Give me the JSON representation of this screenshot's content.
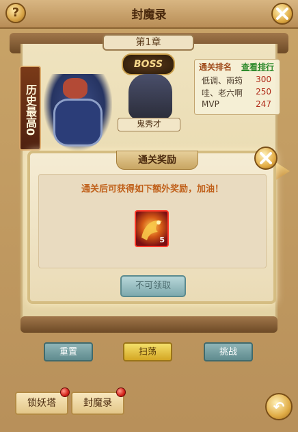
{
  "header": {
    "title": "封魔录",
    "help_icon_text": "?",
    "close_icon": "close-icon"
  },
  "scroll": {
    "chapter_label": "第1章",
    "history_label": "历史最高0"
  },
  "boss": {
    "badge_text": "BOSS",
    "name": "鬼秀才"
  },
  "ranking": {
    "title": "通关排名",
    "link": "查看排行",
    "rows": [
      {
        "name": "低调、雨筠",
        "score": "300"
      },
      {
        "name": "哇、老六啊",
        "score": "250"
      },
      {
        "name": "MVP",
        "score": "247"
      }
    ]
  },
  "modal": {
    "title": "通关奖励",
    "message": "通关后可获得如下额外奖励，加油！",
    "reward": {
      "icon": "dragon-item-icon",
      "count": "5"
    },
    "claim_button": "不可领取",
    "close_icon": "close-icon"
  },
  "actions": {
    "reset": "重置",
    "sweep": "扫荡",
    "challenge": "挑战"
  },
  "bottom_tabs": {
    "lock_demon_tower": "锁妖塔",
    "seal_demon_record": "封魔录"
  },
  "colors": {
    "accent_gold": "#d4a624",
    "teal_button": "#5f8b8e",
    "score_red": "#b02a18",
    "link_green": "#2e8a2c"
  }
}
